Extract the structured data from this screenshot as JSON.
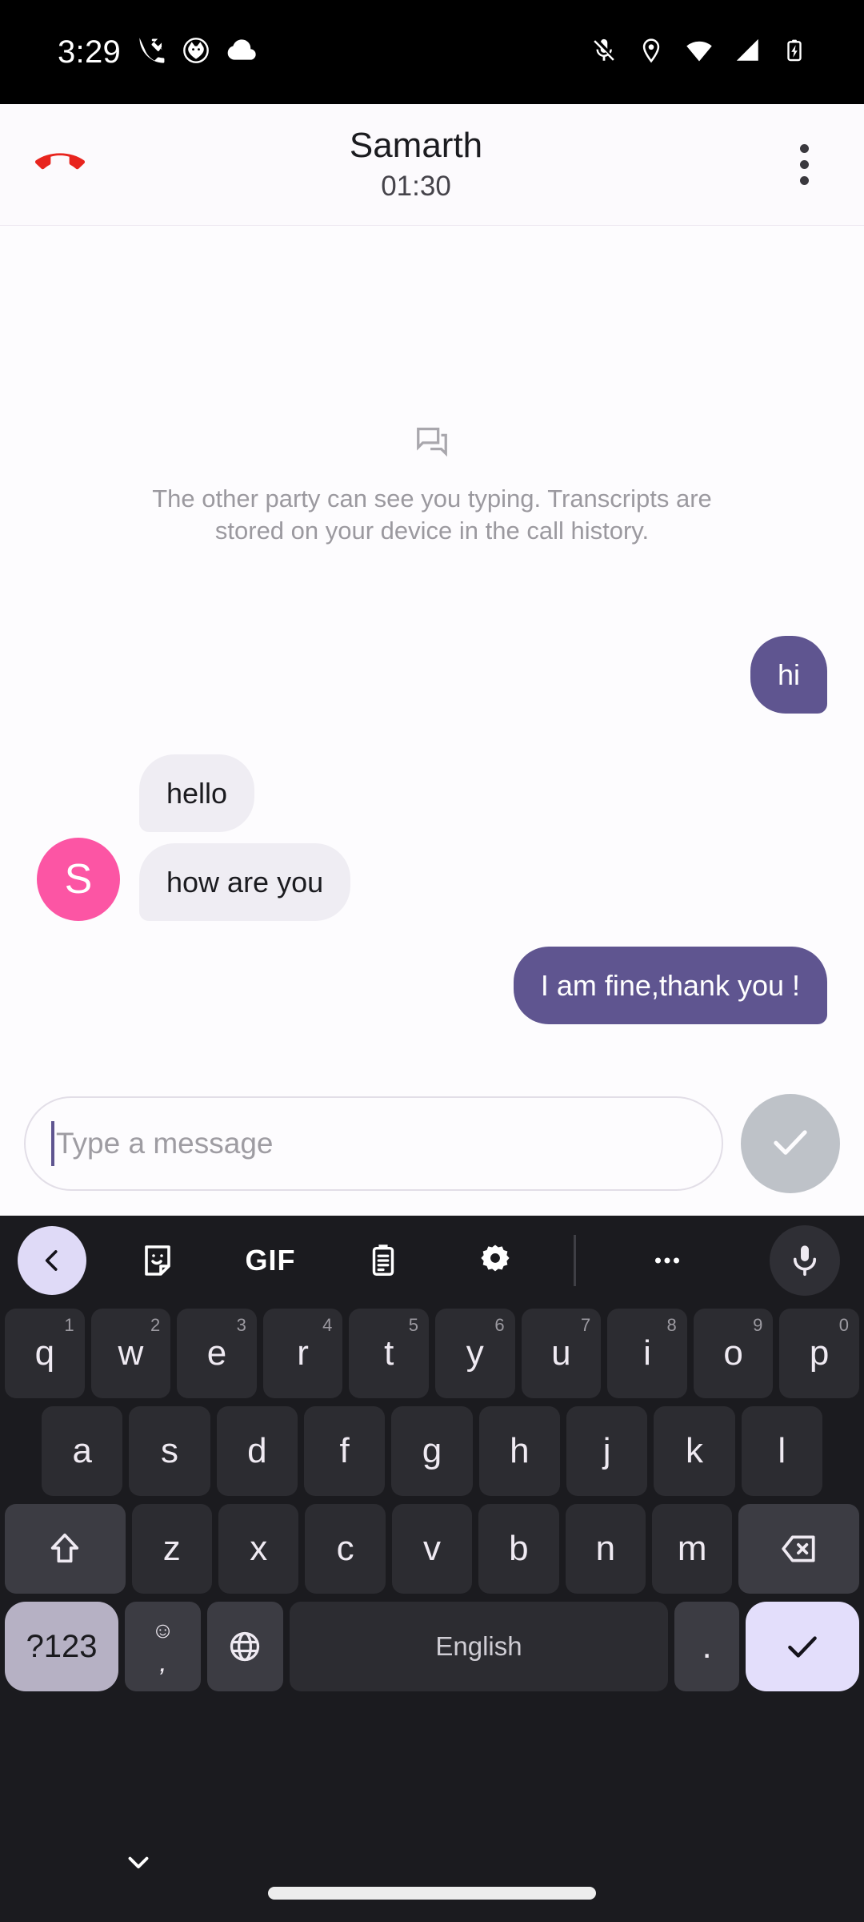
{
  "status_bar": {
    "time": "3:29",
    "left_icons": [
      "phone-missed-icon",
      "cat-face-icon",
      "cloud-icon"
    ],
    "right_icons": [
      "mic-off-icon",
      "location-icon",
      "wifi-icon",
      "signal-icon",
      "battery-charging-icon"
    ]
  },
  "call_header": {
    "end_call_label": "end-call",
    "contact_name": "Samarth",
    "call_duration": "01:30",
    "overflow_label": "more-options"
  },
  "chat": {
    "info_icon": "chat-bubble-icon",
    "info_text": "The other party can see you typing. Transcripts are stored on your device in the call history.",
    "avatar_initial": "S",
    "avatar_color": "#FC55A4",
    "outgoing_bubble_color": "#5F5590",
    "incoming_bubble_color": "#EFEDF3",
    "messages": [
      {
        "id": "m1",
        "direction": "outgoing",
        "text": "hi"
      },
      {
        "id": "m2",
        "direction": "incoming",
        "text": "hello"
      },
      {
        "id": "m3",
        "direction": "incoming",
        "text": "how are you"
      },
      {
        "id": "m4",
        "direction": "outgoing",
        "text": "I am fine,thank you !"
      }
    ]
  },
  "input_bar": {
    "placeholder": "Type a message",
    "value": "",
    "send_icon": "check-icon",
    "send_button_color": "#BEC2C8"
  },
  "keyboard": {
    "toolbar": [
      {
        "name": "back-chevron-icon",
        "label": ""
      },
      {
        "name": "sticker-icon",
        "label": ""
      },
      {
        "name": "gif-icon",
        "label": "GIF"
      },
      {
        "name": "clipboard-icon",
        "label": ""
      },
      {
        "name": "settings-gear-icon",
        "label": ""
      },
      {
        "name": "divider",
        "label": ""
      },
      {
        "name": "more-horizontal-icon",
        "label": ""
      },
      {
        "name": "microphone-icon",
        "label": ""
      }
    ],
    "row1": [
      {
        "key": "q",
        "sup": "1"
      },
      {
        "key": "w",
        "sup": "2"
      },
      {
        "key": "e",
        "sup": "3"
      },
      {
        "key": "r",
        "sup": "4"
      },
      {
        "key": "t",
        "sup": "5"
      },
      {
        "key": "y",
        "sup": "6"
      },
      {
        "key": "u",
        "sup": "7"
      },
      {
        "key": "i",
        "sup": "8"
      },
      {
        "key": "o",
        "sup": "9"
      },
      {
        "key": "p",
        "sup": "0"
      }
    ],
    "row2": [
      "a",
      "s",
      "d",
      "f",
      "g",
      "h",
      "j",
      "k",
      "l"
    ],
    "row3": [
      "z",
      "x",
      "c",
      "v",
      "b",
      "n",
      "m"
    ],
    "shift_label": "shift-icon",
    "backspace_label": "backspace-icon",
    "symbols_key": "?123",
    "emoji_key_top": "☺",
    "emoji_key_bottom": ",",
    "globe_key": "globe-icon",
    "space_label": "English",
    "period_key": ".",
    "enter_key": "check-icon",
    "accent_key_color": "#E3DEFB"
  },
  "nav_bar": {
    "hide_keyboard_icon": "chevron-down-icon",
    "home_indicator": "home-pill"
  }
}
